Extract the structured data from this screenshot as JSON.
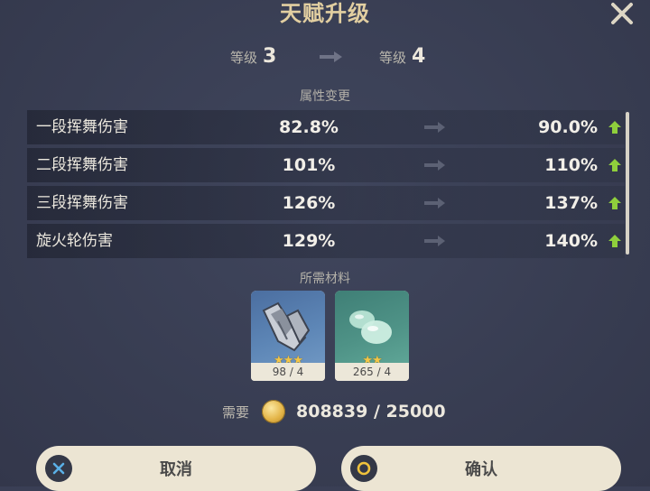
{
  "dialog": {
    "title": "天赋升级",
    "close_icon": "close-icon"
  },
  "levels": {
    "label": "等级",
    "from": "3",
    "to": "4"
  },
  "attributes": {
    "section_label": "属性变更",
    "rows": [
      {
        "name": "一段挥舞伤害",
        "from": "82.8%",
        "to": "90.0%"
      },
      {
        "name": "二段挥舞伤害",
        "from": "101%",
        "to": "110%"
      },
      {
        "name": "三段挥舞伤害",
        "from": "126%",
        "to": "137%"
      },
      {
        "name": "旋火轮伤害",
        "from": "129%",
        "to": "140%"
      }
    ]
  },
  "materials": {
    "section_label": "所需材料",
    "items": [
      {
        "icon": "blade-fragment-icon",
        "stars": "★★★",
        "rarity": 3,
        "count": "98 / 4"
      },
      {
        "icon": "slime-droplet-icon",
        "stars": "★★",
        "rarity": 2,
        "count": "265 / 4"
      }
    ]
  },
  "cost": {
    "label": "需要",
    "icon": "mora-coin-icon",
    "value": "808839 / 25000"
  },
  "buttons": {
    "cancel": {
      "label": "取消",
      "icon": "x-button-icon"
    },
    "confirm": {
      "label": "确认",
      "icon": "circle-button-icon"
    }
  },
  "colors": {
    "background": "#3a3f55",
    "title": "#e2cfa1",
    "increase_arrow": "#8fcf3c",
    "button_bg": "#ece5d3",
    "star": "#f2c649"
  }
}
